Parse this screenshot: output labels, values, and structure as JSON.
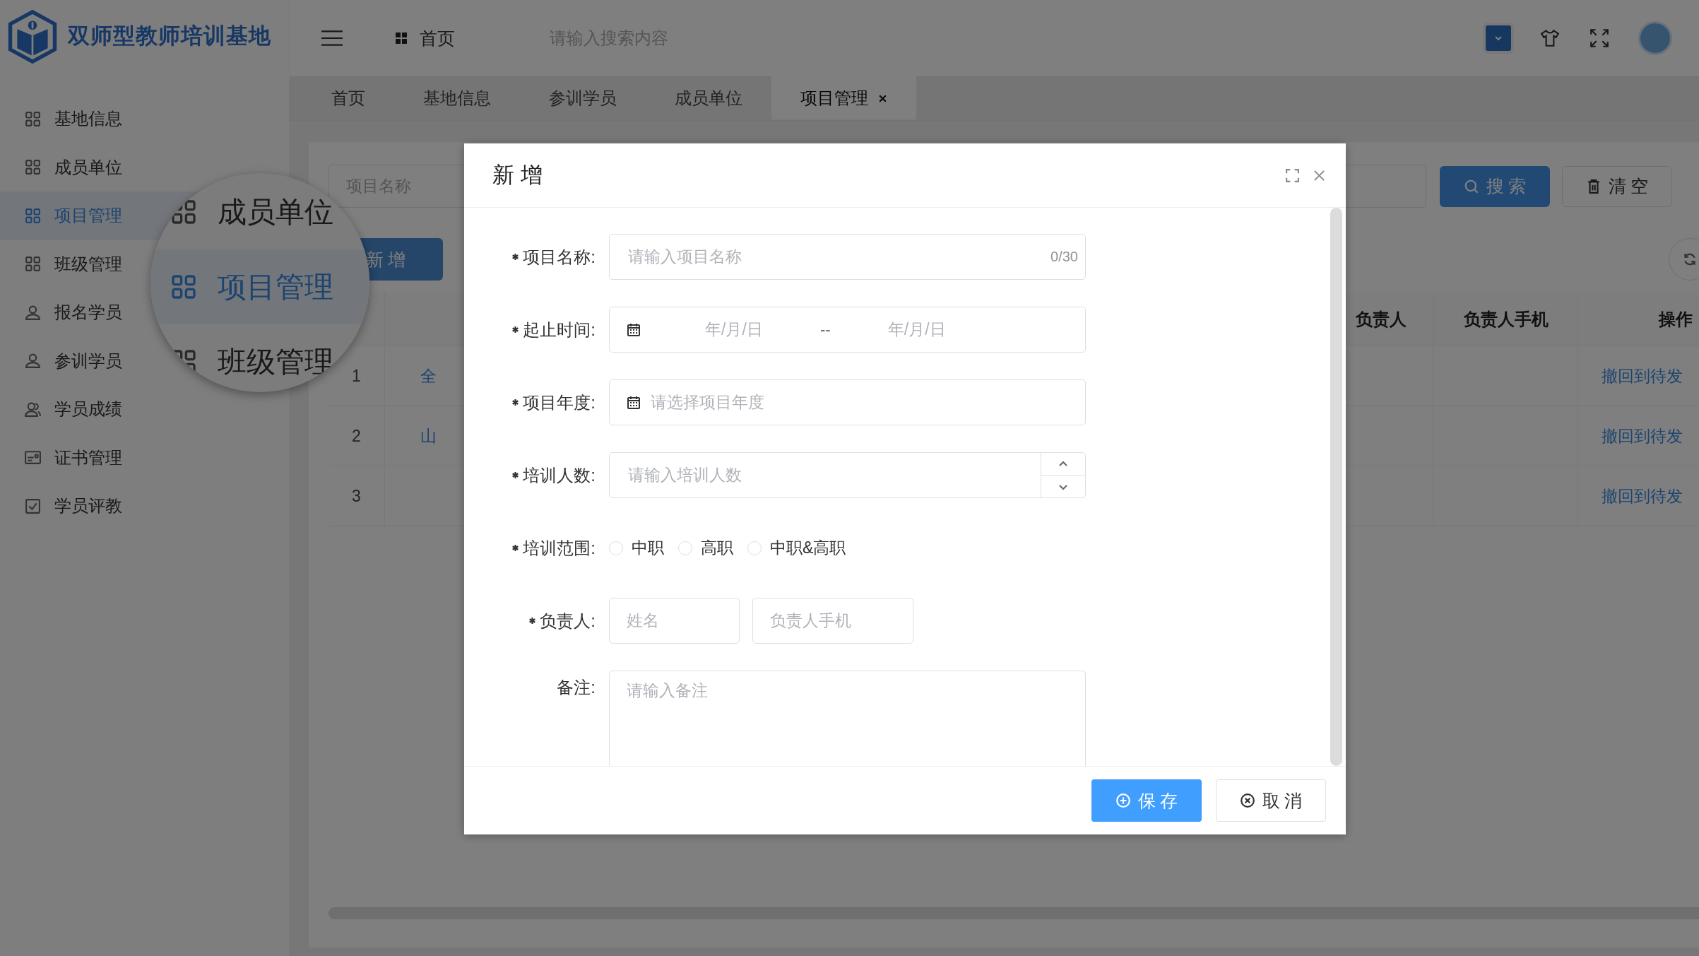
{
  "header": {
    "logo_text": "双师型教师培训基地",
    "breadcrumb": "首页",
    "search": {
      "placeholder": "请输入搜索内容"
    }
  },
  "sidebar": {
    "items": [
      {
        "label": "基地信息",
        "kind": "grid",
        "selected": false
      },
      {
        "label": "成员单位",
        "kind": "grid",
        "selected": false
      },
      {
        "label": "项目管理",
        "kind": "grid",
        "selected": true
      },
      {
        "label": "班级管理",
        "kind": "grid",
        "selected": false
      },
      {
        "label": "报名学员",
        "kind": "user",
        "selected": false
      },
      {
        "label": "参训学员",
        "kind": "user",
        "selected": false
      },
      {
        "label": "学员成绩",
        "kind": "users",
        "selected": false
      },
      {
        "label": "证书管理",
        "kind": "certificate",
        "selected": false
      },
      {
        "label": "学员评教",
        "kind": "checkbox",
        "selected": false
      }
    ]
  },
  "tabs": [
    {
      "label": "首页",
      "selected": false,
      "closable": false
    },
    {
      "label": "基地信息",
      "selected": false,
      "closable": false
    },
    {
      "label": "参训学员",
      "selected": false,
      "closable": false
    },
    {
      "label": "成员单位",
      "selected": false,
      "closable": false
    },
    {
      "label": "项目管理",
      "selected": true,
      "closable": true
    }
  ],
  "magnifier": {
    "items": [
      {
        "label": "成员单位",
        "selected": false
      },
      {
        "label": "项目管理",
        "selected": true
      },
      {
        "label": "班级管理",
        "selected": false
      }
    ]
  },
  "filters": {
    "inputs": [
      {
        "kind": "text",
        "placeholder": "项目名称"
      },
      {
        "kind": "text"
      }
    ],
    "search_button": "搜 索",
    "clear_button": "清 空"
  },
  "add_button": "新 增",
  "table": {
    "columns": [
      "",
      "",
      "负责人",
      "负责人手机",
      "操作"
    ],
    "rows": [
      {
        "index": "1",
        "name": "全",
        "person": "",
        "phone": "",
        "action": "撤回到待发"
      },
      {
        "index": "2",
        "name": "山",
        "person": "",
        "phone": "",
        "action": "撤回到待发"
      },
      {
        "index": "3",
        "name": "",
        "person": "",
        "phone": "",
        "action": "撤回到待发"
      }
    ]
  },
  "dialog": {
    "title": "新 增",
    "fields": [
      {
        "kind": "text",
        "label": "项目名称:",
        "required": true,
        "placeholder": "请输入项目名称",
        "counter": "0/30"
      },
      {
        "kind": "daterange",
        "label": "起止时间:",
        "required": true,
        "start_placeholder": "年/月/日",
        "separator": "--",
        "end_placeholder": "年/月/日"
      },
      {
        "kind": "year",
        "label": "项目年度:",
        "required": true,
        "placeholder": "请选择项目年度"
      },
      {
        "kind": "number",
        "label": "培训人数:",
        "required": true,
        "placeholder": "请输入培训人数"
      },
      {
        "kind": "radio",
        "label": "培训范围:",
        "required": true,
        "options": [
          {
            "label": "中职",
            "selected": false
          },
          {
            "label": "高职",
            "selected": false
          },
          {
            "label": "中职&高职",
            "selected": false
          }
        ]
      },
      {
        "kind": "person",
        "label": "负责人:",
        "required": true,
        "inputs": [
          {
            "placeholder": "姓名"
          },
          {
            "placeholder": "负责人手机"
          }
        ]
      },
      {
        "kind": "textarea",
        "label": "备注:",
        "required": false,
        "placeholder": "请输入备注"
      }
    ],
    "buttons": [
      {
        "kind": "primary",
        "label": "保 存"
      },
      {
        "kind": "default",
        "label": "取 消"
      }
    ]
  }
}
